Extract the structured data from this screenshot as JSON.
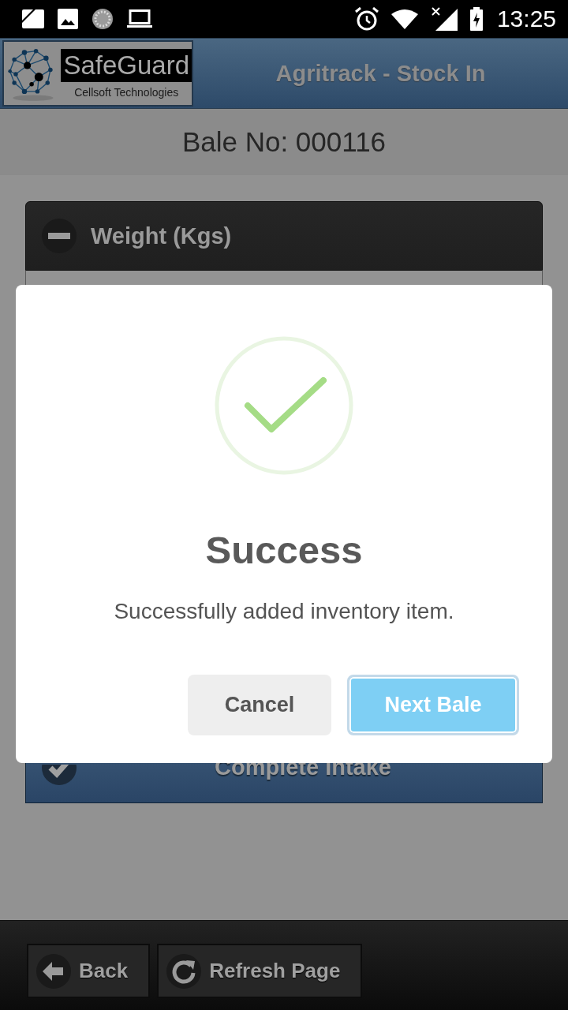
{
  "status_bar": {
    "time": "13:25"
  },
  "header": {
    "logo": {
      "name": "SafeGuard",
      "tagline": "Cellsoft Technologies"
    },
    "title": "Agritrack - Stock In"
  },
  "bale": {
    "label": "Bale No: 000116"
  },
  "sections": [
    {
      "title": "Weight (Kgs)",
      "expanded": true
    }
  ],
  "complete_button": {
    "label": "Complete Intake"
  },
  "dialog": {
    "kind": "success",
    "title": "Success",
    "message": "Successfully added inventory item.",
    "buttons": [
      {
        "label": "Cancel",
        "kind": "cancel",
        "focused": false
      },
      {
        "label": "Next Bale",
        "kind": "confirm",
        "focused": true
      }
    ]
  },
  "footer": {
    "buttons": [
      {
        "label": "Back",
        "kind": "back"
      },
      {
        "label": "Refresh Page",
        "kind": "refresh"
      }
    ]
  }
}
